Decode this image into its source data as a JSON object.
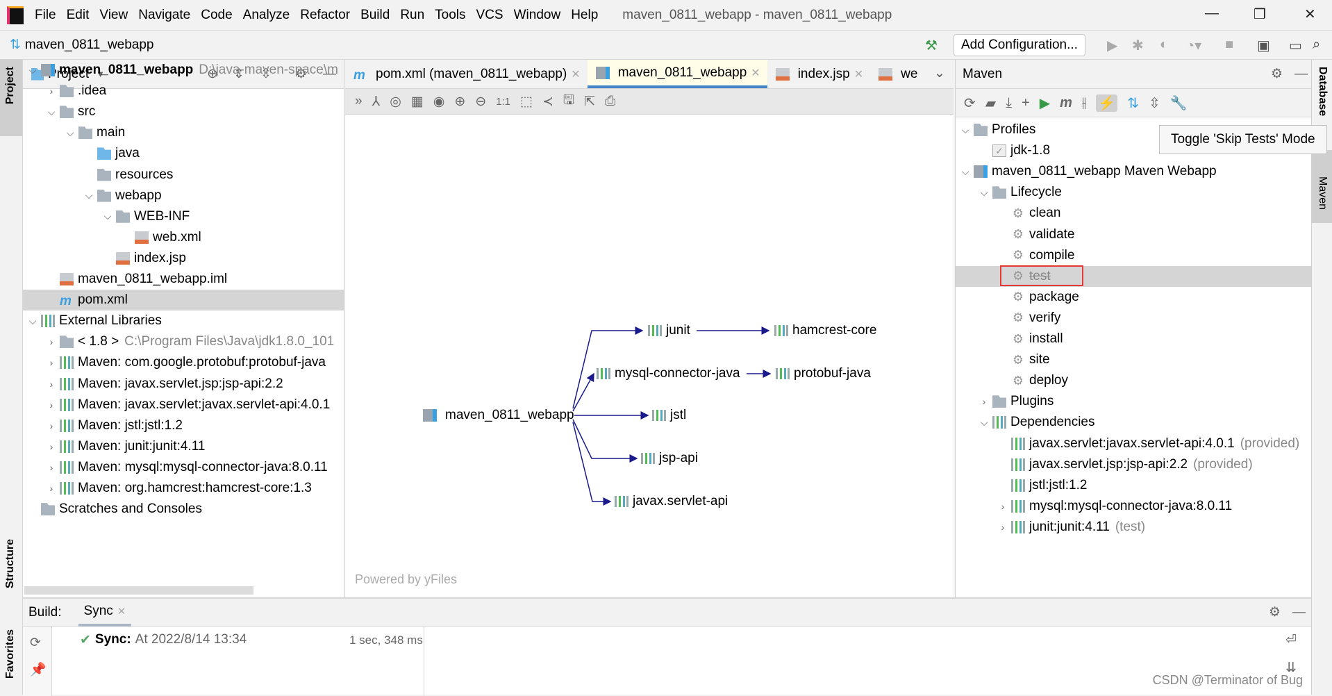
{
  "menubar": {
    "items": [
      "File",
      "Edit",
      "View",
      "Navigate",
      "Code",
      "Analyze",
      "Refactor",
      "Build",
      "Run",
      "Tools",
      "VCS",
      "Window",
      "Help"
    ],
    "window_title": "maven_0811_webapp - maven_0811_webapp"
  },
  "toolbar": {
    "breadcrumb": "maven_0811_webapp",
    "add_configuration": "Add Configuration..."
  },
  "left_strip": {
    "project": "Project",
    "structure": "Structure",
    "favorites": "Favorites"
  },
  "project_panel": {
    "title": "Project",
    "rows": [
      {
        "label": "maven_0811_webapp",
        "extra": "D:\\java-maven-space\\m",
        "depth": 0,
        "arrow": "down",
        "icon": "module",
        "bold": true
      },
      {
        "label": ".idea",
        "depth": 1,
        "arrow": "right",
        "icon": "folder"
      },
      {
        "label": "src",
        "depth": 1,
        "arrow": "down",
        "icon": "folder"
      },
      {
        "label": "main",
        "depth": 2,
        "arrow": "down",
        "icon": "folder"
      },
      {
        "label": "java",
        "depth": 3,
        "arrow": "",
        "icon": "folder-blue"
      },
      {
        "label": "resources",
        "depth": 3,
        "arrow": "",
        "icon": "folder"
      },
      {
        "label": "webapp",
        "depth": 3,
        "arrow": "down",
        "icon": "folder"
      },
      {
        "label": "WEB-INF",
        "depth": 4,
        "arrow": "down",
        "icon": "folder"
      },
      {
        "label": "web.xml",
        "depth": 5,
        "arrow": "",
        "icon": "file"
      },
      {
        "label": "index.jsp",
        "depth": 4,
        "arrow": "",
        "icon": "file"
      },
      {
        "label": "maven_0811_webapp.iml",
        "depth": 1,
        "arrow": "",
        "icon": "file"
      },
      {
        "label": "pom.xml",
        "depth": 1,
        "arrow": "",
        "icon": "maven",
        "selected": true
      },
      {
        "label": "External Libraries",
        "depth": 0,
        "arrow": "down",
        "icon": "library"
      },
      {
        "label": "< 1.8 >",
        "extra": "C:\\Program Files\\Java\\jdk1.8.0_101",
        "depth": 1,
        "arrow": "right",
        "icon": "folder"
      },
      {
        "label": "Maven: com.google.protobuf:protobuf-java",
        "depth": 1,
        "arrow": "right",
        "icon": "library"
      },
      {
        "label": "Maven: javax.servlet.jsp:jsp-api:2.2",
        "depth": 1,
        "arrow": "right",
        "icon": "library"
      },
      {
        "label": "Maven: javax.servlet:javax.servlet-api:4.0.1",
        "depth": 1,
        "arrow": "right",
        "icon": "library"
      },
      {
        "label": "Maven: jstl:jstl:1.2",
        "depth": 1,
        "arrow": "right",
        "icon": "library"
      },
      {
        "label": "Maven: junit:junit:4.11",
        "depth": 1,
        "arrow": "right",
        "icon": "library"
      },
      {
        "label": "Maven: mysql:mysql-connector-java:8.0.11",
        "depth": 1,
        "arrow": "right",
        "icon": "library"
      },
      {
        "label": "Maven: org.hamcrest:hamcrest-core:1.3",
        "depth": 1,
        "arrow": "right",
        "icon": "library"
      },
      {
        "label": "Scratches and Consoles",
        "depth": 0,
        "arrow": "",
        "icon": "scratches"
      }
    ]
  },
  "editor": {
    "tabs": [
      {
        "label": "pom.xml (maven_0811_webapp)",
        "icon": "maven"
      },
      {
        "label": "maven_0811_webapp",
        "icon": "diagram",
        "active": true
      },
      {
        "label": "index.jsp",
        "icon": "jsp"
      },
      {
        "label": "we",
        "icon": "xml"
      }
    ],
    "diagram": {
      "root": "maven_0811_webapp",
      "nodes": [
        "junit",
        "hamcrest-core",
        "mysql-connector-java",
        "protobuf-java",
        "jstl",
        "jsp-api",
        "javax.servlet-api"
      ],
      "powered_by": "Powered by yFiles"
    }
  },
  "maven_panel": {
    "title": "Maven",
    "tooltip": "Toggle 'Skip Tests' Mode",
    "rows": [
      {
        "label": "Profiles",
        "depth": 0,
        "arrow": "down",
        "icon": "profiles"
      },
      {
        "label": "jdk-1.8",
        "depth": 1,
        "arrow": "",
        "icon": "checkbox"
      },
      {
        "label": "maven_0811_webapp Maven Webapp",
        "depth": 0,
        "arrow": "down",
        "icon": "module"
      },
      {
        "label": "Lifecycle",
        "depth": 1,
        "arrow": "down",
        "icon": "folder"
      },
      {
        "label": "clean",
        "depth": 2,
        "icon": "gear"
      },
      {
        "label": "validate",
        "depth": 2,
        "icon": "gear"
      },
      {
        "label": "compile",
        "depth": 2,
        "icon": "gear"
      },
      {
        "label": "test",
        "depth": 2,
        "icon": "gear",
        "selected": true,
        "skipped": true
      },
      {
        "label": "package",
        "depth": 2,
        "icon": "gear"
      },
      {
        "label": "verify",
        "depth": 2,
        "icon": "gear"
      },
      {
        "label": "install",
        "depth": 2,
        "icon": "gear"
      },
      {
        "label": "site",
        "depth": 2,
        "icon": "gear"
      },
      {
        "label": "deploy",
        "depth": 2,
        "icon": "gear"
      },
      {
        "label": "Plugins",
        "depth": 1,
        "arrow": "right",
        "icon": "folder"
      },
      {
        "label": "Dependencies",
        "depth": 1,
        "arrow": "down",
        "icon": "library"
      },
      {
        "label": "javax.servlet:javax.servlet-api:4.0.1",
        "extra": "(provided)",
        "depth": 2,
        "icon": "library"
      },
      {
        "label": "javax.servlet.jsp:jsp-api:2.2",
        "extra": "(provided)",
        "depth": 2,
        "icon": "library"
      },
      {
        "label": "jstl:jstl:1.2",
        "depth": 2,
        "icon": "library"
      },
      {
        "label": "mysql:mysql-connector-java:8.0.11",
        "depth": 2,
        "arrow": "right",
        "icon": "library"
      },
      {
        "label": "junit:junit:4.11",
        "extra": "(test)",
        "depth": 2,
        "arrow": "right",
        "icon": "library"
      }
    ]
  },
  "right_strip": {
    "database": "Database",
    "maven": "Maven"
  },
  "build": {
    "label": "Build:",
    "tab": "Sync",
    "sync_title": "Sync:",
    "sync_text": "At 2022/8/14 13:34",
    "duration": "1 sec, 348 ms"
  },
  "watermark": "CSDN @Terminator of Bug",
  "colors": {
    "accent": "#4083c9",
    "selection": "#d5d5d5",
    "highlight_box": "#e53935",
    "edge": "#1a1a8c",
    "success": "#59a869"
  }
}
